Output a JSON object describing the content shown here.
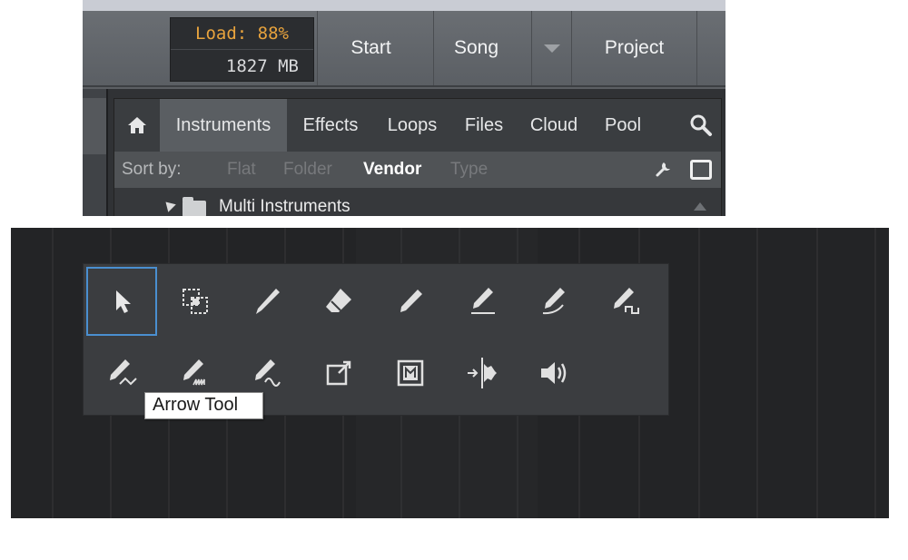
{
  "transport": {
    "load_label": "Load: 88%",
    "memory_label": "1827 MB",
    "start_label": "Start",
    "song_label": "Song",
    "song_dropdown_icon": "triangle-down-icon",
    "project_label": "Project"
  },
  "browser": {
    "home_icon": "home-icon",
    "tabs": [
      {
        "label": "Instruments",
        "active": true
      },
      {
        "label": "Effects"
      },
      {
        "label": "Loops"
      },
      {
        "label": "Files"
      },
      {
        "label": "Cloud"
      },
      {
        "label": "Pool"
      }
    ],
    "search_icon": "magnifier-icon",
    "sort": {
      "label": "Sort by:",
      "options": [
        "Flat",
        "Folder",
        "Vendor",
        "Type"
      ],
      "selected": "Vendor"
    },
    "tree": [
      {
        "label": "Multi Instruments",
        "expanded": true,
        "icon": "folder-icon"
      }
    ]
  },
  "tool_palette": {
    "selected_tool": "arrow",
    "tools_row1": [
      "arrow-icon",
      "range-select-icon",
      "split-knife-icon",
      "eraser-icon",
      "pencil-icon",
      "pencil-line-icon",
      "pencil-parabola-icon",
      "pencil-square-icon"
    ],
    "tools_row2": [
      "pencil-triangle-icon",
      "pencil-sawtooth-icon",
      "pencil-sine-icon",
      "bend-icon",
      "mute-icon",
      "listen-icon",
      "speaker-icon"
    ],
    "tooltip": "Arrow Tool"
  },
  "colors": {
    "selection_outline": "#4a8fd0",
    "load_text": "#e8a33d",
    "editor_bg": "#232426",
    "palette_bg": "#3b3d40"
  }
}
